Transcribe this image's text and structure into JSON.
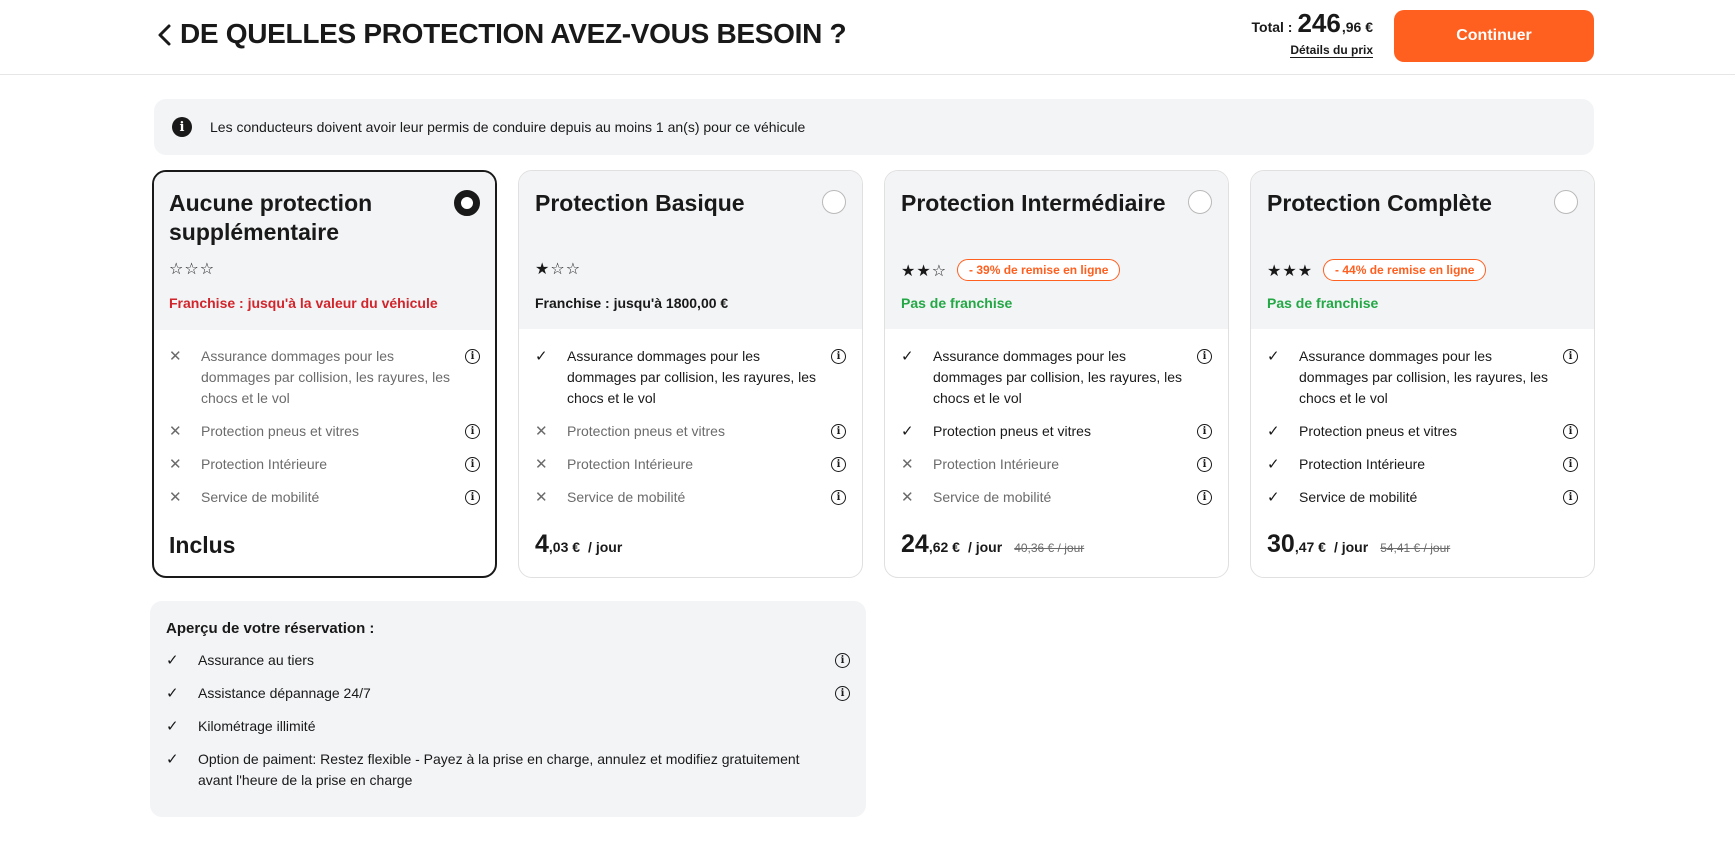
{
  "header": {
    "title": "DE QUELLES PROTECTION AVEZ-VOUS BESOIN ?",
    "total_label": "Total :",
    "total_int": "246",
    "total_dec": ",96 €",
    "details_link": "Détails du prix",
    "cta_label": "Continuer"
  },
  "banner": {
    "text": "Les conducteurs doivent avoir leur permis de conduire depuis au moins 1 an(s) pour ce véhicule"
  },
  "cards": [
    {
      "title": "Aucune protection supplémentaire",
      "stars": "☆☆☆",
      "discount": "",
      "franchise": "Franchise : jusqu'à la valeur du véhicule",
      "features": [
        {
          "text": "Assurance dommages pour les dommages par collision, les rayures, les chocs et le vol",
          "mark": "✕"
        },
        {
          "text": "Protection pneus et vitres",
          "mark": "✕"
        },
        {
          "text": "Protection Intérieure",
          "mark": "✕"
        },
        {
          "text": "Service de mobilité",
          "mark": "✕"
        }
      ],
      "price_included": "Inclus"
    },
    {
      "title": "Protection Basique",
      "stars": "★☆☆",
      "discount": "",
      "franchise": "Franchise : jusqu'à 1800,00 €",
      "features": [
        {
          "text": "Assurance dommages pour les dommages par collision, les rayures, les chocs et le vol",
          "mark": "✓"
        },
        {
          "text": "Protection pneus et vitres",
          "mark": "✕"
        },
        {
          "text": "Protection Intérieure",
          "mark": "✕"
        },
        {
          "text": "Service de mobilité",
          "mark": "✕"
        }
      ],
      "price_int": "4",
      "price_dec": ",03 €",
      "price_unit": "/ jour"
    },
    {
      "title": "Protection Intermédiaire",
      "stars": "★★☆",
      "discount": "- 39% de remise en ligne",
      "franchise": "Pas de franchise",
      "features": [
        {
          "text": "Assurance dommages pour les dommages par collision, les rayures, les chocs et le vol",
          "mark": "✓"
        },
        {
          "text": "Protection pneus et vitres",
          "mark": "✓"
        },
        {
          "text": "Protection Intérieure",
          "mark": "✕"
        },
        {
          "text": "Service de mobilité",
          "mark": "✕"
        }
      ],
      "price_int": "24",
      "price_dec": ",62 €",
      "price_unit": "/ jour",
      "price_old": "40,36 € / jour"
    },
    {
      "title": "Protection Complète",
      "stars": "★★★",
      "discount": "- 44% de remise en ligne",
      "franchise": "Pas de franchise",
      "features": [
        {
          "text": "Assurance dommages pour les dommages par collision, les rayures, les chocs et le vol",
          "mark": "✓"
        },
        {
          "text": "Protection pneus et vitres",
          "mark": "✓"
        },
        {
          "text": "Protection Intérieure",
          "mark": "✓"
        },
        {
          "text": "Service de mobilité",
          "mark": "✓"
        }
      ],
      "price_int": "30",
      "price_dec": ",47 €",
      "price_unit": "/ jour",
      "price_old": "54,41 € / jour"
    }
  ],
  "overview": {
    "title": "Aperçu de votre réservation :",
    "items": [
      {
        "text": "Assurance au tiers",
        "mark": "✓"
      },
      {
        "text": "Assistance dépannage 24/7",
        "mark": "✓"
      },
      {
        "text": "Kilométrage illimité",
        "mark": "✓"
      },
      {
        "text": "Option de paiment: Restez flexible - Payez à la prise en charge, annulez et modifiez gratuitement avant l'heure de la prise en charge",
        "mark": "✓"
      }
    ]
  },
  "icons": {
    "back": "chevron-left-icon",
    "info": "info-icon",
    "check": "check-icon",
    "cross": "close-icon"
  },
  "colors": {
    "accent": "#ff5f1f",
    "franchise_red": "#d1252b",
    "franchise_green": "#23a845",
    "panel": "#f3f4f6"
  }
}
